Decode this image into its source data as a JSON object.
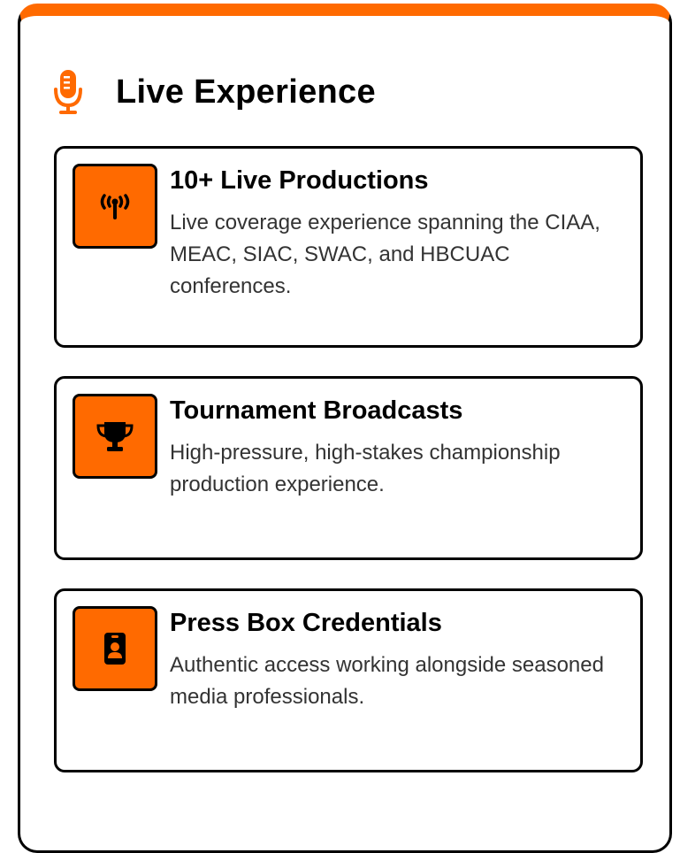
{
  "section": {
    "title": "Live Experience",
    "icon": "microphone-icon",
    "accent_color": "#FF6A00"
  },
  "cards": [
    {
      "title": "10+ Live Productions",
      "description": "Live coverage experience spanning the CIAA, MEAC, SIAC, SWAC, and HBCUAC conferences.",
      "icon": "broadcast-tower-icon"
    },
    {
      "title": "Tournament Broadcasts",
      "description": "High-pressure, high-stakes championship production experience.",
      "icon": "trophy-icon"
    },
    {
      "title": "Press Box Credentials",
      "description": "Authentic access working alongside seasoned media professionals.",
      "icon": "id-badge-icon"
    }
  ]
}
